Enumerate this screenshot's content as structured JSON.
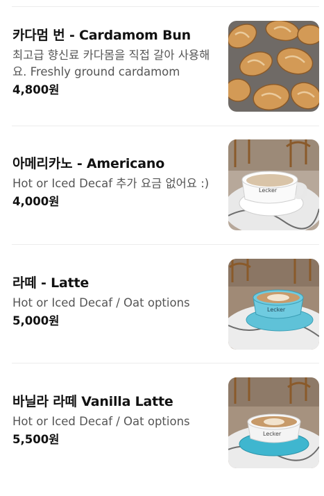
{
  "menu": {
    "items": [
      {
        "title": "카다멈 번 - Cardamom Bun",
        "description": "최고급 향신료 카다몸을 직접 갈아 사용해요. Freshly ground cardamom",
        "price": "4,800원",
        "image_icon": "cardamom-bun-photo"
      },
      {
        "title": "아메리카노 - Americano",
        "description": "Hot or Iced Decaf 추가 요금 없어요 :)",
        "price": "4,000원",
        "image_icon": "americano-photo"
      },
      {
        "title": "라떼 - Latte",
        "description": "Hot or Iced Decaf / Oat options",
        "price": "5,000원",
        "image_icon": "latte-photo"
      },
      {
        "title": "바닐라 라떼 Vanilla Latte",
        "description": "Hot or Iced Decaf / Oat options",
        "price": "5,500원",
        "image_icon": "vanilla-latte-photo"
      }
    ]
  }
}
